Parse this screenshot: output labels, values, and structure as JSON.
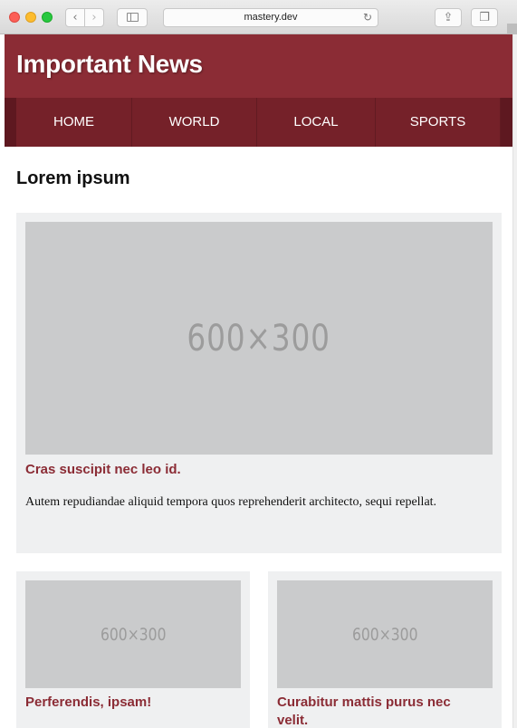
{
  "browser": {
    "url": "mastery.dev",
    "back_glyph": "‹",
    "forward_glyph": "›",
    "reload_glyph": "↻",
    "share_glyph": "⇪",
    "tabs_glyph": "❐"
  },
  "site": {
    "title": "Important News",
    "nav": [
      "HOME",
      "WORLD",
      "LOCAL",
      "SPORTS"
    ]
  },
  "main": {
    "heading": "Lorem ipsum",
    "feature": {
      "placeholder": "600×300",
      "title": "Cras suscipit nec leo id.",
      "text": "Autem repudiandae aliquid tempora quos reprehenderit architecto, sequi repellat."
    },
    "cards": [
      {
        "placeholder": "600×300",
        "title": "Perferendis, ipsam!"
      },
      {
        "placeholder": "600×300",
        "title": "Curabitur mattis purus nec velit."
      }
    ]
  },
  "colors": {
    "header": "#8b2c35",
    "nav": "#752129",
    "accent_title": "#8b2c35",
    "card_bg": "#eff0f1",
    "placeholder_bg": "#cacbcc"
  }
}
